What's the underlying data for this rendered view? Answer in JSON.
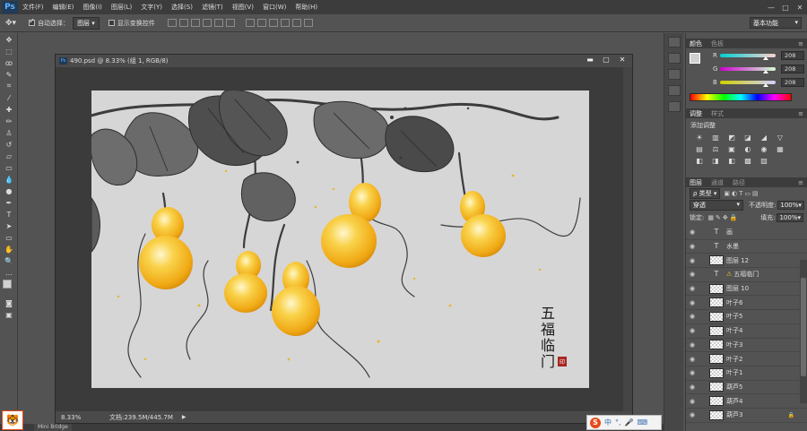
{
  "menu": {
    "logo": "Ps",
    "items": [
      "文件(F)",
      "编辑(E)",
      "图像(I)",
      "图层(L)",
      "文字(Y)",
      "选择(S)",
      "滤镜(T)",
      "视图(V)",
      "窗口(W)",
      "帮助(H)"
    ],
    "window_buttons": [
      "—",
      "□",
      "✕"
    ]
  },
  "options": {
    "auto_select_label": "自动选择：",
    "auto_select_value": "图层",
    "show_transform_label": "显示变换控件",
    "workspace": "基本功能"
  },
  "document": {
    "title": "490.psd @ 8.33% (组 1, RGB/8)",
    "zoom": "8.33%",
    "status": "文档:239.5M/445.7M",
    "artwork_title_chars": [
      "五",
      "福",
      "临",
      "门"
    ],
    "seal_text": "印"
  },
  "color_panel": {
    "tabs": [
      "颜色",
      "色板"
    ],
    "channels": [
      {
        "label": "R",
        "value": "208"
      },
      {
        "label": "G",
        "value": "208"
      },
      {
        "label": "B",
        "value": "208"
      }
    ],
    "foreground_color": "#d0d0d0",
    "background_color": "#ffffff"
  },
  "adjustments_panel": {
    "tabs": [
      "调整",
      "样式"
    ],
    "add_label": "添加调整",
    "icons": [
      "☀",
      "▥",
      "◩",
      "◪",
      "◢",
      "▽",
      "▤",
      "⚖",
      "▣",
      "◐",
      "◉",
      "▦",
      "◧",
      "◨",
      "◧",
      "▩",
      "▨"
    ]
  },
  "layers_panel": {
    "tabs": [
      "图层",
      "通道",
      "路径"
    ],
    "filter_label": "ρ 类型",
    "blend_mode": "穿透",
    "opacity_label": "不透明度:",
    "opacity_value": "100%",
    "lock_label": "锁定:",
    "fill_label": "填充:",
    "fill_value": "100%",
    "layers": [
      {
        "name": "画",
        "kind": "text",
        "visible": true
      },
      {
        "name": "水墨",
        "kind": "text",
        "visible": true
      },
      {
        "name": "图层 12",
        "kind": "pixel",
        "visible": true
      },
      {
        "name": "五福临门",
        "kind": "text-warning",
        "visible": true
      },
      {
        "name": "图层 10",
        "kind": "pixel",
        "visible": true
      },
      {
        "name": "叶子6",
        "kind": "pixel",
        "visible": true
      },
      {
        "name": "叶子5",
        "kind": "pixel",
        "visible": true
      },
      {
        "name": "叶子4",
        "kind": "pixel",
        "visible": true
      },
      {
        "name": "叶子3",
        "kind": "pixel",
        "visible": true
      },
      {
        "name": "叶子2",
        "kind": "pixel",
        "visible": true
      },
      {
        "name": "叶子1",
        "kind": "pixel",
        "visible": true
      },
      {
        "name": "葫芦5",
        "kind": "pixel",
        "visible": true
      },
      {
        "name": "葫芦4",
        "kind": "pixel",
        "visible": true
      },
      {
        "name": "葫芦3",
        "kind": "pixel",
        "visible": true,
        "locked": true
      }
    ]
  },
  "bottom": {
    "mini_bridge": "Mini Bridge",
    "ime": [
      "中",
      "°,",
      "🎤",
      "⌨"
    ]
  }
}
